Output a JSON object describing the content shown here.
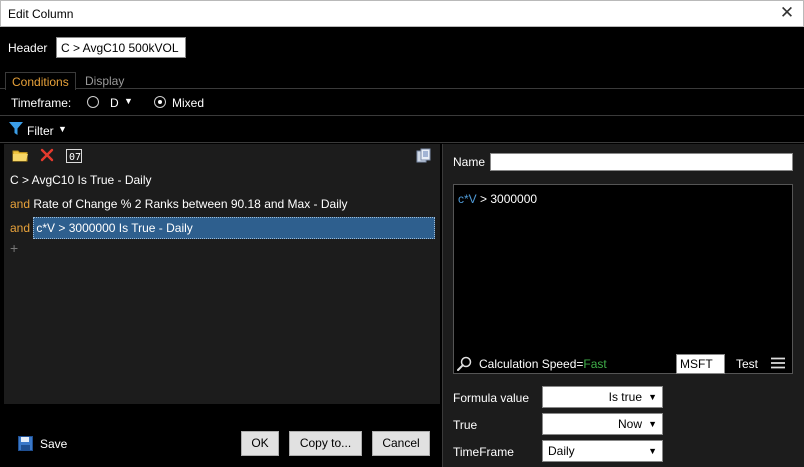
{
  "window": {
    "title": "Edit Column",
    "close_icon": "close-icon"
  },
  "header": {
    "label": "Header",
    "value": "C > AvgC10 500kVOL"
  },
  "tabs": [
    {
      "label": "Conditions",
      "active": true
    },
    {
      "label": "Display",
      "active": false
    }
  ],
  "timeframe": {
    "label": "Timeframe:",
    "option_d": "D",
    "option_mixed": "Mixed",
    "selected": "Mixed"
  },
  "filter": {
    "label": "Filter"
  },
  "conditions": [
    {
      "prefix": "",
      "text": "C > AvgC10 Is True - Daily"
    },
    {
      "prefix": "and",
      "text": "Rate of Change % 2 Ranks between 90.18 and Max - Daily"
    },
    {
      "prefix": "and",
      "text": "c*V > 3000000 Is True - Daily",
      "selected": true
    }
  ],
  "add_symbol": "+",
  "toolbar_icons": [
    "folder-icon",
    "delete-icon",
    "counter-icon",
    "copy-icon"
  ],
  "buttons": {
    "save": "Save",
    "ok": "OK",
    "copy_to": "Copy to...",
    "cancel": "Cancel"
  },
  "formula_panel": {
    "name_label": "Name",
    "name_value": "",
    "formula_prefix": "c*V",
    "formula_rest": " > 3000000",
    "speed_label": "Calculation Speed=",
    "speed_value": "Fast",
    "symbol": "MSFT",
    "test_label": "Test",
    "formula_value_label": "Formula value",
    "formula_value": "Is true",
    "true_label": "True",
    "true_value": "Now",
    "timeframe_label": "TimeFrame",
    "timeframe_value": "Daily"
  },
  "colors": {
    "accent": "#e8a23a",
    "selection": "#2e5f8e",
    "formula": "#4f9bd8",
    "fast": "#3fae49"
  }
}
